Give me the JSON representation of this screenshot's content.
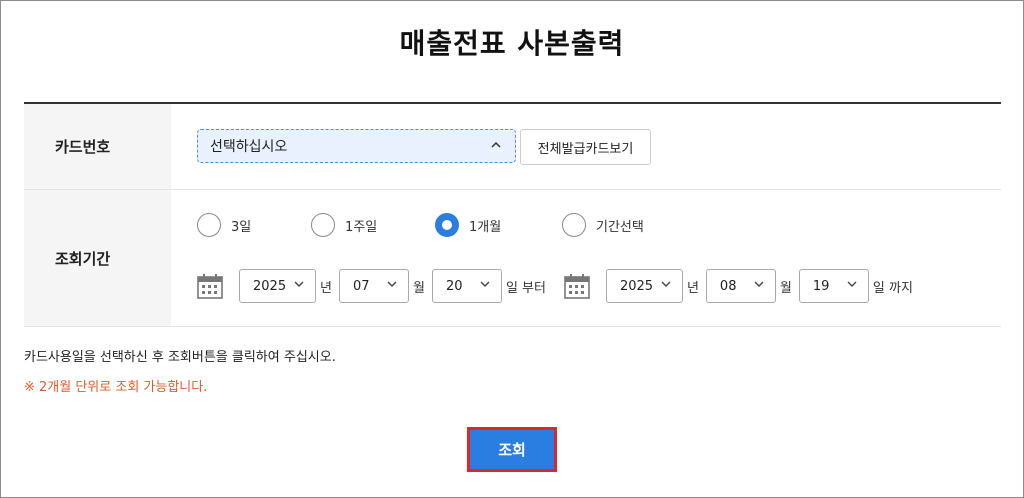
{
  "page": {
    "title": "매출전표 사본출력"
  },
  "card_row": {
    "label": "카드번호",
    "select_value": "선택하십시오",
    "view_all_label": "전체발급카드보기"
  },
  "period_row": {
    "label": "조회기간",
    "radios": [
      {
        "label": "3일",
        "checked": false
      },
      {
        "label": "1주일",
        "checked": false
      },
      {
        "label": "1개월",
        "checked": true
      },
      {
        "label": "기간선택",
        "checked": false
      }
    ],
    "start": {
      "year": "2025",
      "month": "07",
      "day": "20"
    },
    "end": {
      "year": "2025",
      "month": "08",
      "day": "19"
    },
    "unit_year": "년",
    "unit_month": "월",
    "from_suffix": "일 부터",
    "to_suffix": "일 까지"
  },
  "notes": {
    "line1": "카드사용일을 선택하신 후 조회버튼을 클릭하여 주십시오.",
    "line2": "※ 2개월 단위로 조회 가능합니다."
  },
  "search_button": {
    "label": "조회"
  },
  "colors": {
    "accent": "#2a7de1",
    "highlight_border": "#e02626",
    "notice": "#e05b2a"
  },
  "icons": {
    "calendar": "calendar-icon",
    "chevron_up": "chevron-up-icon",
    "chevron_down": "chevron-down-icon"
  }
}
